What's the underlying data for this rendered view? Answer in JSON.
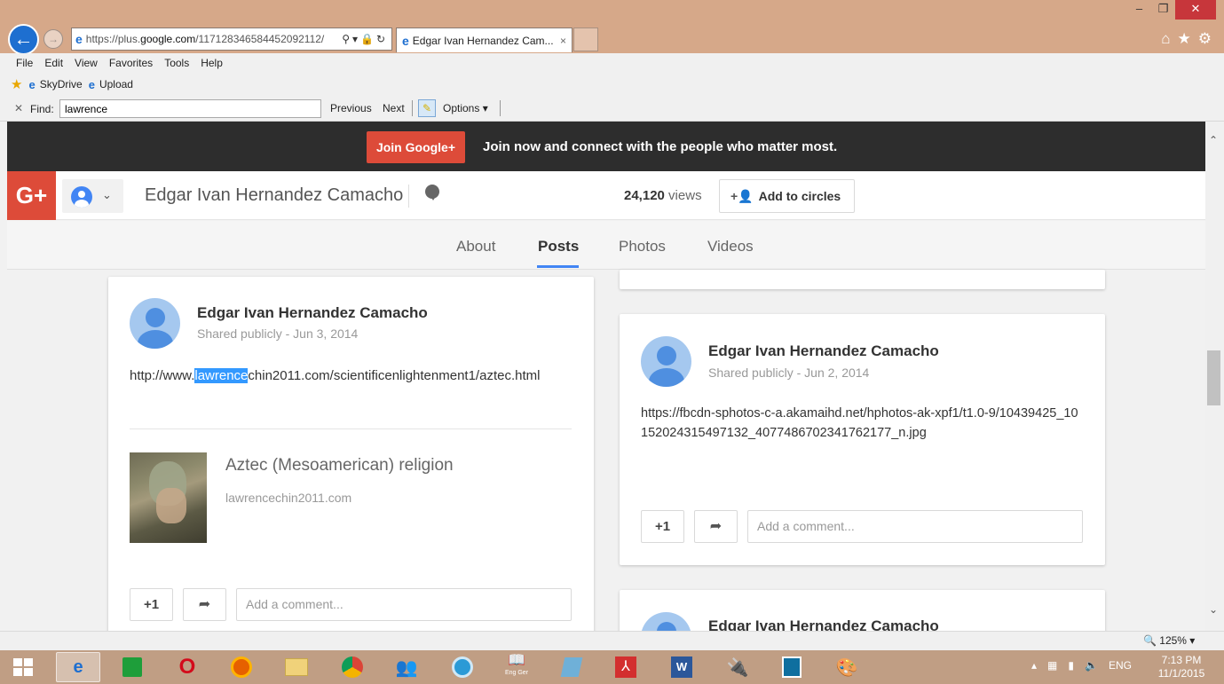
{
  "browser": {
    "url_prefix": "https://plus.",
    "url_domain": "google.com",
    "url_path": "/117128346584452092112/",
    "tab_title": "Edgar Ivan Hernandez Cam...",
    "tab_close": "×",
    "menu": [
      "File",
      "Edit",
      "View",
      "Favorites",
      "Tools",
      "Help"
    ],
    "favorites": [
      "SkyDrive",
      "Upload"
    ],
    "find": {
      "label": "Find:",
      "value": "lawrence",
      "previous": "Previous",
      "next": "Next",
      "options": "Options ▾"
    },
    "zoom": "🔍 125%  ▾"
  },
  "page": {
    "join_button": "Join Google+",
    "join_text": "Join now and connect with the people who matter most.",
    "logo": "G+",
    "profile_name": "Edgar Ivan Hernandez Camacho",
    "views_count": "24,120",
    "views_label": " views",
    "add_circles": "Add to circles",
    "tabs": [
      "About",
      "Posts",
      "Photos",
      "Videos"
    ],
    "active_tab": "Posts"
  },
  "posts": [
    {
      "author": "Edgar Ivan Hernandez Camacho",
      "meta": "Shared publicly  -  Jun 3, 2014",
      "text_before": "http://www.",
      "text_highlight": "lawrence",
      "text_after": "chin2011.com/scientificenlightenment1/aztec.html",
      "link_title": "Aztec (Mesoamerican) religion",
      "link_domain": "lawrencechin2011.com",
      "plus_one": "+1",
      "comment_placeholder": "Add a comment..."
    },
    {
      "author": "Edgar Ivan Hernandez Camacho",
      "meta": "Shared publicly  -  Jun 2, 2014",
      "text": "https://fbcdn-sphotos-c-a.akamaihd.net/hphotos-ak-xpf1/t1.0-9/10439425_10152024315497132_4077486702341762177_n.jpg",
      "plus_one": "+1",
      "comment_placeholder": "Add a comment..."
    },
    {
      "author": "Edgar Ivan Hernandez Camacho"
    }
  ],
  "taskbar": {
    "language": "ENG",
    "time": "7:13 PM",
    "date": "11/1/2015",
    "dictionary_label": "Eng Ger"
  }
}
